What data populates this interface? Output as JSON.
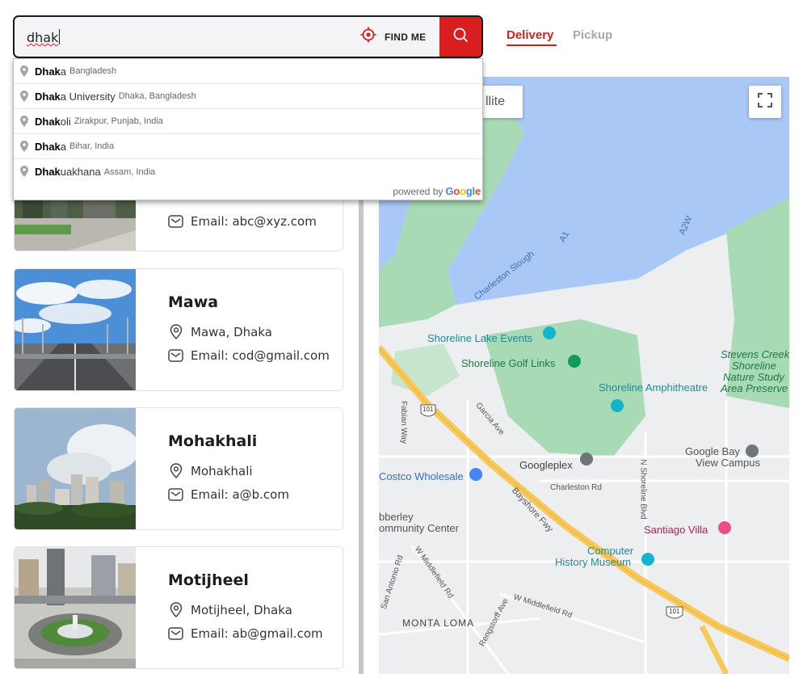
{
  "search": {
    "value": "dhak",
    "find_me_label": "FIND ME"
  },
  "tabs": [
    {
      "label": "Delivery",
      "active": true
    },
    {
      "label": "Pickup",
      "active": false
    }
  ],
  "suggestions": [
    {
      "match": "Dhak",
      "rest": "a",
      "secondary": "Bangladesh"
    },
    {
      "match": "Dhak",
      "rest": "a University",
      "secondary": "Dhaka, Bangladesh"
    },
    {
      "match": "Dhak",
      "rest": "oli",
      "secondary": "Zirakpur, Punjab, India"
    },
    {
      "match": "Dhak",
      "rest": "a",
      "secondary": "Bihar, India"
    },
    {
      "match": "Dhak",
      "rest": "uakhana",
      "secondary": "Assam, India"
    }
  ],
  "powered_by": "powered by",
  "google_letters": [
    {
      "ch": "G",
      "color": "#4285F4"
    },
    {
      "ch": "o",
      "color": "#EA4335"
    },
    {
      "ch": "o",
      "color": "#FBBC05"
    },
    {
      "ch": "g",
      "color": "#4285F4"
    },
    {
      "ch": "l",
      "color": "#34A853"
    },
    {
      "ch": "e",
      "color": "#EA4335"
    }
  ],
  "stores": [
    {
      "title": "",
      "address": "",
      "email": "Email: abc@xyz.com"
    },
    {
      "title": "Mawa",
      "address": "Mawa, Dhaka",
      "email": "Email: cod@gmail.com"
    },
    {
      "title": "Mohakhali",
      "address": "Mohakhali",
      "email": "Email: a@b.com"
    },
    {
      "title": "Motijheel",
      "address": "Motijheel, Dhaka",
      "email": "Email: ab@gmail.com"
    }
  ],
  "map": {
    "satellite_label": "llite",
    "labels": {
      "charleston_slough": "Charleston Slough",
      "a1": "A1",
      "a2w": "A2W",
      "shoreline_lake": "Shoreline Lake Events",
      "shoreline_golf": "Shoreline Golf Links",
      "amphitheatre": "Shoreline Amphitheatre",
      "stevens_creek_1": "Stevens Creek",
      "stevens_creek_2": "Shoreline",
      "stevens_creek_3": "Nature Study",
      "stevens_creek_4": "Area Preserve",
      "fabian_way": "Fabian Way",
      "garcia_ave": "Garcia Ave",
      "googleplex": "Googleplex",
      "google_bay_1": "Google Bay",
      "google_bay_2": "View Campus",
      "costco": "Costco Wholesale",
      "charleston_rd": "Charleston Rd",
      "n_shoreline": "N Shoreline Blvd",
      "bayshore": "Bayshore Fwy",
      "community_1": "bberley",
      "community_2": "ommunity Center",
      "santiago": "Santiago Villa",
      "computer_1": "Computer",
      "computer_2": "History Museum",
      "w_middlefield_1": "W Middlefield Rd",
      "w_middlefield_2": "W Middlefield Rd",
      "san_antonio": "San Antonio Rd",
      "monta_loma": "MONTA LOMA",
      "rengstorff": "Rengstorff Ave",
      "shield_101_a": "101",
      "shield_101_b": "101"
    }
  },
  "colors": {
    "accent": "#d81e1e",
    "water": "#aac8f6",
    "park": "#a8dab5",
    "highway": "#f6c95a"
  }
}
